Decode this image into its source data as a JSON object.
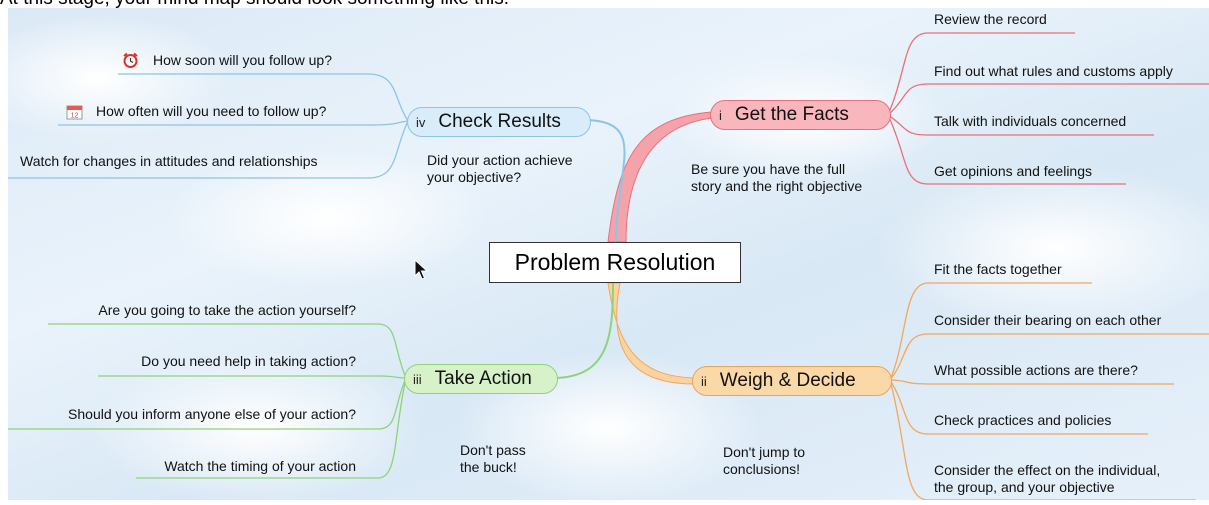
{
  "intro": "At this stage, your mind map should look something like this:",
  "central": "Problem Resolution",
  "branches": {
    "facts": {
      "number": "i",
      "label": "Get the Facts",
      "note_line1": "Be sure you have the full",
      "note_line2": "story and the right objective",
      "items": [
        "Review the record",
        "Find out what rules and customs apply",
        "Talk with individuals concerned",
        "Get opinions and feelings"
      ],
      "color": "#e8707b"
    },
    "weigh": {
      "number": "ii",
      "label": "Weigh & Decide",
      "note_line1": "Don't jump to",
      "note_line2": "conclusions!",
      "items": [
        "Fit the facts together",
        "Consider their bearing on each other",
        "What possible actions are there?",
        "Check practices and policies"
      ],
      "last_item_line1": "Consider the effect on the individual,",
      "last_item_line2": "the group, and your objective",
      "color": "#f2a75a"
    },
    "action": {
      "number": "iii",
      "label": "Take Action",
      "note_line1": "Don't pass",
      "note_line2": "the buck!",
      "items": [
        "Are you going to take the action yourself?",
        "Do you need help in taking action?",
        "Should you inform anyone else of your action?",
        "Watch the timing of your action"
      ],
      "color": "#8fd27a"
    },
    "check": {
      "number": "iv",
      "label": "Check Results",
      "note_line1": "Did your action achieve",
      "note_line2": "your objective?",
      "items": [
        "How soon will you follow up?",
        "How often will you need to follow up?",
        "Watch for changes in attitudes and relationships"
      ],
      "item_icons": [
        "alarm-clock-icon",
        "calendar-icon",
        ""
      ],
      "calendar_icon_text": "12",
      "color": "#8cc4e8"
    }
  }
}
